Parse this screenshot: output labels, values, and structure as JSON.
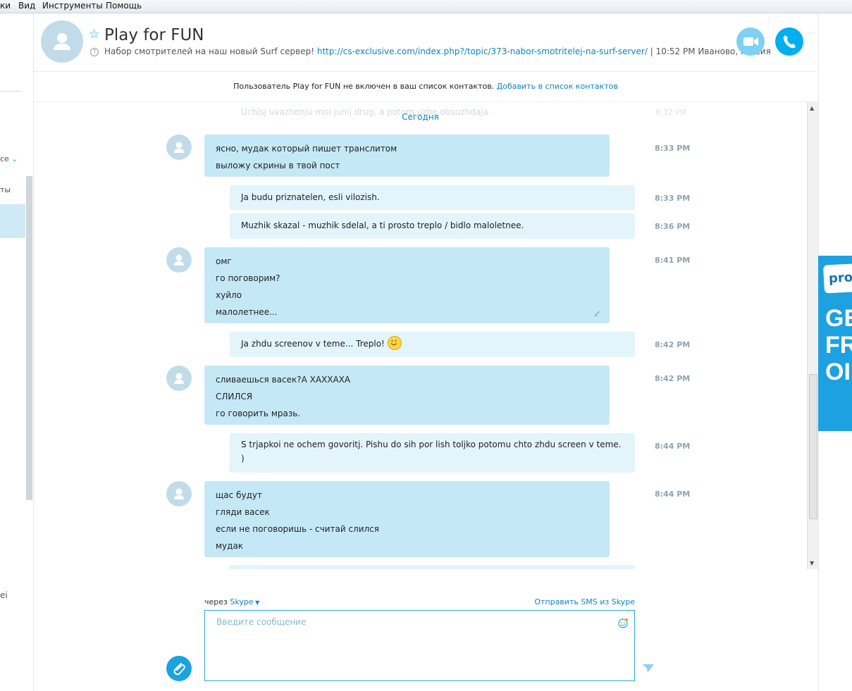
{
  "menubar": {
    "items": [
      "ки",
      "Вид",
      "Инструменты",
      "Помощь"
    ]
  },
  "sidebar": {
    "labels": [
      "се",
      "ты",
      "ei"
    ]
  },
  "header": {
    "contact_name": "Play for FUN",
    "mood_text": "Набор смотрителей на наш новый Surf сервер!",
    "mood_link": "http://cs-exclusive.com/index.php?/topic/373-nabor-smotritelej-na-surf-server/",
    "local_info": "| 10:52 PM Иваново, Россия"
  },
  "notice": {
    "text": "Пользователь Play for FUN не включен в ваш список контактов.",
    "link": "Добавить в список контактов"
  },
  "chat": {
    "ghost_text": "Uchisj uvazhenju moi junij drug, a potom uzhe obsuzhdaja.",
    "ghost_time": "8:32 PM",
    "today_label": "Сегодня",
    "messages": [
      {
        "dir": "in",
        "time": "8:33 PM",
        "lines": [
          "ясно, мудак который пишет транслитом",
          "выложу скрины в твой пост"
        ]
      },
      {
        "dir": "out",
        "time": "8:33 PM",
        "lines": [
          "Ja budu priznatelen, esli vilozish."
        ]
      },
      {
        "dir": "out",
        "time": "8:36 PM",
        "lines": [
          "Muzhik skazal - muzhik sdelal, a ti prosto treplo / bidlo maloletnee."
        ]
      },
      {
        "dir": "in",
        "time": "8:41 PM",
        "lines": [
          "омг",
          "го поговорим?",
          "хуйло",
          "малолетнее..."
        ]
      },
      {
        "dir": "out",
        "time": "8:42 PM",
        "lines": [
          "Ja zhdu screenov v teme... Treplo!"
        ]
      },
      {
        "dir": "in",
        "time": "8:42 PM",
        "lines": [
          "сливаешься васек?А ХАХХАХА",
          "СЛИЛСЯ",
          "го говорить мразь."
        ]
      },
      {
        "dir": "out",
        "time": "8:44 PM",
        "lines": [
          "S trjapkoi ne ochem govoritj. Pishu do sih por lish toljko potomu chto zhdu screen v teme. )"
        ]
      },
      {
        "dir": "in",
        "time": "8:44 PM",
        "lines": [
          "щас будут",
          "гляди васек",
          "если не поговоришь - считай слился",
          "мудак"
        ]
      }
    ]
  },
  "composer": {
    "via_prefix": "через",
    "via_service": "Skype",
    "sms_link": "Отправить SMS из Skype",
    "placeholder": "Введите сообщение"
  },
  "ad": {
    "logo": "pro",
    "headline": "GE\nFR\nOI"
  },
  "colors": {
    "accent": "#00aff0",
    "incoming_bubble": "#c5e8f7",
    "outgoing_bubble": "#e3f4fb",
    "link": "#0b86c4"
  }
}
